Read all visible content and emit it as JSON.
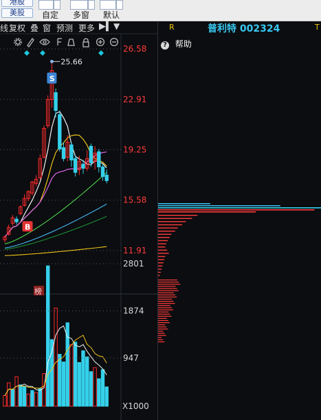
{
  "toolbar": {
    "top_button_label": "港股",
    "us_button_label": "美股",
    "custom_label": "自定",
    "multi_window_label": "多窗",
    "default_label": "默认"
  },
  "chart_toolbar": {
    "items": [
      "线",
      "复权",
      "叠",
      "窗",
      "预测",
      "更多"
    ],
    "toggle_label": "▶▍",
    "menu_label": "▼"
  },
  "stock": {
    "name": "普利特 002324",
    "r_label": "R",
    "t_label": "T"
  },
  "help": {
    "label": "帮助",
    "icon_label": "?"
  },
  "chart_data": {
    "type": "candlestick",
    "price_axis_ticks": [
      "26.58",
      "22.91",
      "19.25",
      "15.58",
      "11.91"
    ],
    "high_annotation": "25.66",
    "sell_marker": "S",
    "buy_marker": "B",
    "list_marker": "榜",
    "volume_axis_ticks": [
      "2801",
      "1874",
      "947"
    ],
    "volume_unit": "X1000",
    "colors": {
      "up": "#ff2b2b",
      "down": "#35d0ea",
      "ma5": "#f3f3f3",
      "ma10": "#f0c419",
      "ma20": "#e064e8",
      "ma30": "#4fd44f",
      "ma60": "#46b7f4",
      "ma120": "#1f8f38",
      "ma250": "#f0c419"
    },
    "candles": [
      {
        "o": 12.7,
        "c": 12.9,
        "h": 13.0,
        "l": 12.5
      },
      {
        "o": 13.1,
        "c": 13.6,
        "h": 13.8,
        "l": 13.0
      },
      {
        "o": 13.9,
        "c": 14.3,
        "h": 14.5,
        "l": 13.7
      },
      {
        "o": 14.2,
        "c": 14.0,
        "h": 14.4,
        "l": 13.8
      },
      {
        "o": 14.6,
        "c": 15.1,
        "h": 15.2,
        "l": 14.5
      },
      {
        "o": 15.2,
        "c": 15.7,
        "h": 16.0,
        "l": 15.1
      },
      {
        "o": 15.7,
        "c": 16.2,
        "h": 16.3,
        "l": 15.5
      },
      {
        "o": 16.1,
        "c": 16.9,
        "h": 17.0,
        "l": 15.9
      },
      {
        "o": 16.8,
        "c": 17.1,
        "h": 17.4,
        "l": 16.6
      },
      {
        "o": 17.2,
        "c": 18.6,
        "h": 18.9,
        "l": 17.1
      },
      {
        "o": 18.7,
        "c": 20.8,
        "h": 21.0,
        "l": 18.6
      },
      {
        "o": 21.0,
        "c": 22.9,
        "h": 23.2,
        "l": 20.8
      },
      {
        "o": 22.9,
        "c": 25.0,
        "h": 25.66,
        "l": 22.3
      },
      {
        "o": 23.4,
        "c": 22.1,
        "h": 23.7,
        "l": 21.6
      },
      {
        "o": 21.8,
        "c": 19.3,
        "h": 22.1,
        "l": 19.1
      },
      {
        "o": 19.4,
        "c": 18.6,
        "h": 19.8,
        "l": 18.4
      },
      {
        "o": 18.7,
        "c": 19.8,
        "h": 20.3,
        "l": 18.4
      },
      {
        "o": 19.6,
        "c": 18.5,
        "h": 19.8,
        "l": 18.0
      },
      {
        "o": 18.6,
        "c": 17.6,
        "h": 18.9,
        "l": 17.3
      },
      {
        "o": 17.8,
        "c": 18.4,
        "h": 18.8,
        "l": 17.4
      },
      {
        "o": 18.2,
        "c": 17.9,
        "h": 18.5,
        "l": 17.5
      },
      {
        "o": 17.9,
        "c": 18.6,
        "h": 19.2,
        "l": 17.7
      },
      {
        "o": 19.5,
        "c": 18.3,
        "h": 19.7,
        "l": 18.0
      },
      {
        "o": 18.4,
        "c": 19.0,
        "h": 19.5,
        "l": 17.8
      },
      {
        "o": 19.1,
        "c": 18.0,
        "h": 19.3,
        "l": 17.6
      },
      {
        "o": 18.0,
        "c": 17.3,
        "h": 18.2,
        "l": 17.0
      },
      {
        "o": 17.4,
        "c": 17.0,
        "h": 17.8,
        "l": 16.8
      }
    ],
    "volumes": [
      {
        "v": 210,
        "up": true
      },
      {
        "v": 460,
        "up": true
      },
      {
        "v": 330,
        "up": false
      },
      {
        "v": 580,
        "up": true
      },
      {
        "v": 420,
        "up": false
      },
      {
        "v": 390,
        "up": false
      },
      {
        "v": 240,
        "up": true
      },
      {
        "v": 310,
        "up": false
      },
      {
        "v": 270,
        "up": true
      },
      {
        "v": 350,
        "up": false
      },
      {
        "v": 640,
        "up": true
      },
      {
        "v": 2760,
        "up": false
      },
      {
        "v": 1310,
        "up": false
      },
      {
        "v": 1930,
        "up": true
      },
      {
        "v": 1020,
        "up": false
      },
      {
        "v": 870,
        "up": false
      },
      {
        "v": 1640,
        "up": false
      },
      {
        "v": 1210,
        "up": true
      },
      {
        "v": 1260,
        "up": false
      },
      {
        "v": 860,
        "up": false
      },
      {
        "v": 1090,
        "up": false
      },
      {
        "v": 970,
        "up": false
      },
      {
        "v": 680,
        "up": false
      },
      {
        "v": 760,
        "up": true
      },
      {
        "v": 540,
        "up": false
      },
      {
        "v": 720,
        "up": false
      },
      {
        "v": 380,
        "up": false
      }
    ],
    "price_axis_range": [
      11.0,
      27.5
    ],
    "volume_axis_range": [
      0,
      2900
    ],
    "chip_distribution": [
      {
        "v": 0.44,
        "c": "#ff3b3b"
      },
      {
        "v": 0.38,
        "c": "#ff3b3b"
      },
      {
        "v": 0.31,
        "c": "#ff3b3b"
      },
      {
        "v": 0.27,
        "c": "#ff3b3b"
      },
      {
        "v": 0.22,
        "c": "#ff3b3b"
      },
      {
        "v": 0.19,
        "c": "#ff3b3b"
      },
      {
        "v": 0.15,
        "c": "#ff3b3b"
      },
      {
        "v": 0.13,
        "c": "#ff3b3b"
      },
      {
        "v": 0.11,
        "c": "#ff3b3b"
      },
      {
        "v": 0.09,
        "c": "#ff3b3b"
      },
      {
        "v": 0.08,
        "c": "#ff3b3b"
      },
      {
        "v": 0.1,
        "c": "#ff3b3b"
      },
      {
        "v": 0.12,
        "c": "#ff3b3b"
      },
      {
        "v": 0.08,
        "c": "#ff3b3b"
      },
      {
        "v": 0.07,
        "c": "#ff3b3b"
      },
      {
        "v": 0.06,
        "c": "#ff3b3b"
      },
      {
        "v": 0.05,
        "c": "#ff3b3b"
      },
      {
        "v": 0.04,
        "c": "#ff3b3b"
      },
      {
        "v": 0.03,
        "c": "#ff3b3b"
      },
      {
        "v": 0.02,
        "c": "#ff3b3b"
      }
    ],
    "chip_top": [
      {
        "v": 0.32,
        "c": "#38b8e8"
      },
      {
        "v": 0.75,
        "c": "#38b8e8"
      },
      {
        "v": 1.0,
        "c": "#39d0ec"
      },
      {
        "v": 0.96,
        "c": "#ff3b3b"
      },
      {
        "v": 0.6,
        "c": "#ff3b3b"
      }
    ]
  }
}
